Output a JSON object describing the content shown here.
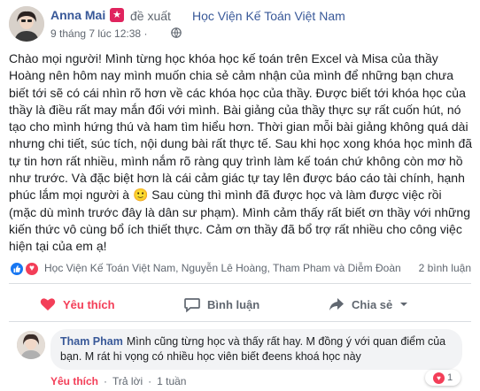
{
  "post": {
    "author": "Anna Mai",
    "recommend_text": "đề xuất",
    "page_name": "Học Viện Kế Toán Việt Nam",
    "timestamp": "9 tháng 7 lúc 12:38",
    "sep": "·",
    "body": "Chào mọi người! Mình từng học khóa học kế toán trên Excel và Misa của thầy\nHoàng nên hôm nay mình muốn chia sẻ cảm nhận của mình để những bạn chưa\nbiết tới sẽ có cái nhìn rõ hơn về các khóa học của thầy. Được biết tới khóa học của\nthầy là điều rất may mắn đối với mình. Bài giảng của thầy thực sự rất cuốn hút, nó\ntạo cho mình hứng thú và ham tìm hiểu hơn. Thời gian mỗi bài giảng không quá dài\nnhưng chi tiết, súc tích, nội dung bài rất thực tế. Sau khi học xong khóa học mình đã\ntự tin hơn rất nhiều, mình nắm rõ ràng quy trình làm kế toán chứ không còn mơ hồ\nnhư trước. Và đặc biệt hơn là cái cảm giác tự tay lên được báo cáo tài chính, hạnh\nphúc lắm mọi người à 🙂 Sau cùng thì mình đã được học và làm được việc rồi\n(mặc dù mình trước đây là dân sư phạm). Mình cảm thấy rất biết ơn thầy với những\nkiến thức vô cùng bổ ích thiết thực. Cảm ơn thầy đã bổ trợ rất nhiều cho công việc\nhiện tại của em ạ!"
  },
  "reactions": {
    "names": "Học Viện Kế Toán Việt Nam, Nguyễn Lê Hoàng, Tham Pham và Diễm Đoàn",
    "comments_count": "2 bình luận"
  },
  "actions": {
    "like_label": "Yêu thích",
    "comment_label": "Bình luận",
    "share_label": "Chia sẻ"
  },
  "comment": {
    "author": "Tham Pham",
    "text": "Mình cũng từng học và thấy rất hay. M đồng ý với quan điểm của bạn. M rát hi vọng có nhiều học viên biết đeens khoá học này",
    "like_label": "Yêu thích",
    "reply_label": "Trả lời",
    "time": "1 tuần",
    "reaction_count": "1"
  },
  "colors": {
    "link": "#385898",
    "love": "#f33e58",
    "like": "#1877f2",
    "muted": "#606770"
  }
}
